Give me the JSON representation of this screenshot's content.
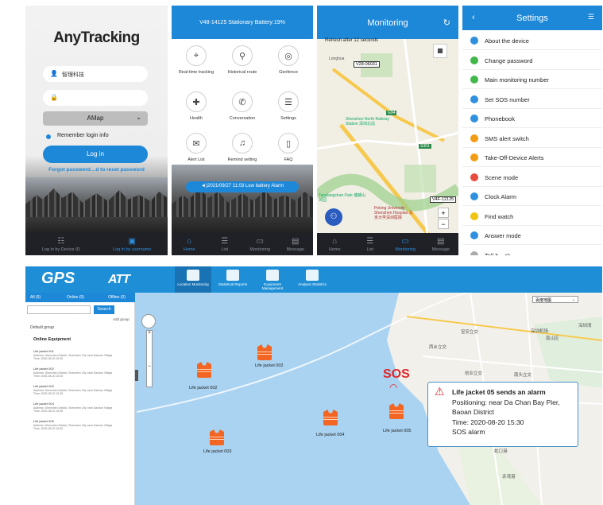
{
  "login": {
    "logo": "AnyTracking",
    "username": "智理科技",
    "map_select": "AMap",
    "remember": "Remember login info",
    "login_btn": "Log in",
    "forgot": "Forgot password…d to reset password",
    "tab_device": "Log in by Device ID",
    "tab_user": "Log in by username"
  },
  "home": {
    "header": "V48-14125 Stationary Battery:19%",
    "items": [
      "Real-time tracking",
      "Historical route",
      "Geofence",
      "Health",
      "Conversation",
      "Settings",
      "Alert List",
      "Remind setting",
      "FAQ"
    ],
    "alarm": "◄)2021/09/27 11:03 Low battery Alarm",
    "tabs": [
      "Home",
      "List",
      "Monitoring",
      "Message"
    ]
  },
  "monitor": {
    "title": "Monitoring",
    "refresh": "Refresh after 12 seconds",
    "tag1": "V28-06031",
    "tag2": "V4F-12125",
    "place1": "Shenzhen North Railway Station 深圳北站",
    "place2": "Tanglangshan Park 塘朗山公园",
    "place3": "Peking University Shenzhen Hospital 北京大学深圳医院",
    "place4": "Longhua",
    "road1": "S301",
    "road2": "G94",
    "tabs": [
      "Home",
      "List",
      "Monitoring",
      "Message"
    ]
  },
  "settings": {
    "title": "Settings",
    "items": [
      "About the device",
      "Change password",
      "Main monitoring number",
      "Set SOS number",
      "Phonebook",
      "SMS alert switch",
      "Take-Off-Device Alerts",
      "Scene mode",
      "Clock Alarm",
      "Find watch",
      "Answer mode",
      "Tell b…ck"
    ],
    "colors": [
      "#2f90e0",
      "#43b84a",
      "#43b84a",
      "#2f90e0",
      "#2f90e0",
      "#f39c12",
      "#f39c12",
      "#e74c3c",
      "#2f90e0",
      "#f1c40f",
      "#2f90e0",
      "#aaa"
    ]
  },
  "desk": {
    "logo": "GPS",
    "brand": "ATT",
    "nav": [
      "Location Monitoring",
      "Statistical Reports",
      "Equipment Management",
      "Analysis Statistics"
    ],
    "tab_all": "All (5)",
    "tab_online": "Online (5)",
    "tab_offline": "Offline (0)",
    "search": "Search",
    "add_group": "Add group",
    "default_group": "Default group",
    "online_equipment": "Online Equipment",
    "map_select": "百度地图",
    "devices": [
      {
        "name": "Life jacket 001",
        "addr": "Address: Shenzhen District, Shenzhen City near Dachan Village",
        "time": "Time: 2020-08-20 15:30"
      },
      {
        "name": "Life jacket 002",
        "addr": "Address: Shenzhen District, Shenzhen City near Dachan Village",
        "time": "Time: 2020-08-20 15:30"
      },
      {
        "name": "Life jacket 003",
        "addr": "Address: Shenzhen District, Shenzhen City near Dachan Village",
        "time": "Time: 2020-08-20 15:30"
      },
      {
        "name": "Life jacket 004",
        "addr": "Address: Shenzhen District, Shenzhen City near Dachan Village",
        "time": "Time: 2020-08-20 15:30"
      },
      {
        "name": "Life jacket 005",
        "addr": "Address: Shenzhen District, Shenzhen City near Dachan Village",
        "time": "Time: 2020-08-20 15:30"
      }
    ],
    "jackets": [
      "Life jacket 002",
      "Life jacket 002",
      "Life jacket 003",
      "Life jacket 004",
      "Life jacket 005"
    ],
    "sos": "SOS",
    "popup": {
      "title": "Life jacket 05 sends an alarm",
      "line1": "Positioning: near Da Chan Bay Pier,",
      "line2": "Baoan District",
      "line3": "Time: 2020-08-20 15:30",
      "line4": "SOS alarm"
    },
    "map_labels": [
      "深圳机场",
      "宝安立交",
      "西乡立交",
      "创业立交",
      "南头立交",
      "南山区",
      "蛇口港",
      "赤湾港",
      "深圳湾"
    ]
  }
}
